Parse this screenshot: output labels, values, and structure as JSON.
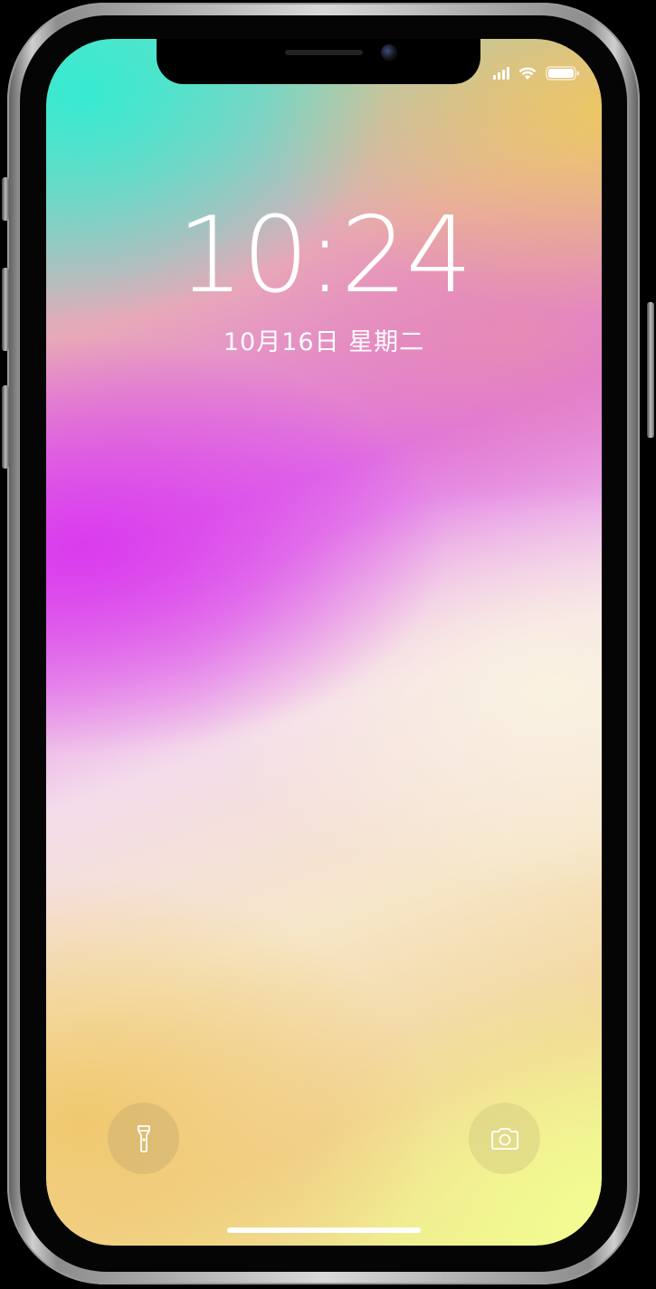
{
  "device": {
    "model": "iPhone X",
    "frame_color": "#d9d9d9"
  },
  "status_bar": {
    "signal_icon": "cellular-signal-icon",
    "wifi_icon": "wifi-icon",
    "battery_icon": "battery-full-icon"
  },
  "lock_screen": {
    "time": "10:24",
    "date": "10月16日 星期二"
  },
  "quick_actions": {
    "flashlight_icon": "flashlight-icon",
    "camera_icon": "camera-icon"
  },
  "colors": {
    "text": "#ffffff",
    "wallpaper_teal": "#32ebd2",
    "wallpaper_magenta": "#da3cee",
    "wallpaper_cream": "#faf2e1",
    "wallpaper_yellow": "#f2fc91"
  }
}
